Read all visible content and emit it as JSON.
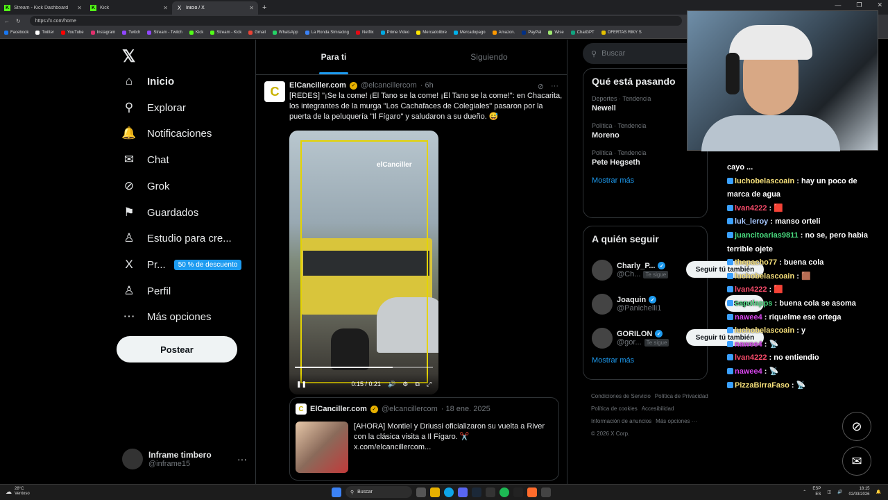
{
  "browser": {
    "tabs": [
      {
        "label": "Stream - Kick Dashboard",
        "icon": "kick-icon",
        "active": false
      },
      {
        "label": "Kick",
        "icon": "kick-icon",
        "active": false
      },
      {
        "label": "Inicio / X",
        "icon": "x-icon",
        "active": true
      }
    ],
    "url": "https://x.com/home",
    "bookmarks": [
      {
        "label": "Facebook",
        "color": "#1877f2"
      },
      {
        "label": "Twitter",
        "color": "#ffffff"
      },
      {
        "label": "YouTube",
        "color": "#ff0000"
      },
      {
        "label": "Instagram",
        "color": "#e1306c"
      },
      {
        "label": "Twitch",
        "color": "#9146ff"
      },
      {
        "label": "Stream - Twitch",
        "color": "#9146ff"
      },
      {
        "label": "Kick",
        "color": "#53fc18"
      },
      {
        "label": "Stream - Kick",
        "color": "#53fc18"
      },
      {
        "label": "Gmail",
        "color": "#ea4335"
      },
      {
        "label": "WhatsApp",
        "color": "#25d366"
      },
      {
        "label": "La Ronda Simracing",
        "color": "#3b82f6"
      },
      {
        "label": "Netflix",
        "color": "#e50914"
      },
      {
        "label": "Prime Video",
        "color": "#00a8e1"
      },
      {
        "label": "Mercadolibre",
        "color": "#ffe600"
      },
      {
        "label": "Mercadopago",
        "color": "#00b1ea"
      },
      {
        "label": "Amazon.",
        "color": "#ff9900"
      },
      {
        "label": "PayPal",
        "color": "#003087"
      },
      {
        "label": "Wise",
        "color": "#9fe870"
      },
      {
        "label": "ChatGPT",
        "color": "#10a37f"
      },
      {
        "label": "OFERTAS RIKY S",
        "color": "#e5c100"
      }
    ]
  },
  "nav": {
    "items": [
      {
        "label": "Inicio",
        "icon": "home-icon",
        "glyph": "⌂",
        "bold": true
      },
      {
        "label": "Explorar",
        "icon": "search-icon",
        "glyph": "⚲"
      },
      {
        "label": "Notificaciones",
        "icon": "bell-icon",
        "glyph": "🔔"
      },
      {
        "label": "Chat",
        "icon": "mail-icon",
        "glyph": "✉"
      },
      {
        "label": "Grok",
        "icon": "grok-icon",
        "glyph": "⊘"
      },
      {
        "label": "Guardados",
        "icon": "bookmark-icon",
        "glyph": "⚑"
      },
      {
        "label": "Estudio para cre...",
        "icon": "studio-icon",
        "glyph": "♙"
      },
      {
        "label": "Pr...",
        "icon": "x-premium-icon",
        "glyph": "X"
      },
      {
        "label": "Perfil",
        "icon": "person-icon",
        "glyph": "♙"
      },
      {
        "label": "Más opciones",
        "icon": "more-circle-icon",
        "glyph": "⋯"
      }
    ],
    "promo_badge": "50 % de descuento",
    "post_button": "Postear",
    "account": {
      "name": "Inframe timbero",
      "handle": "@inframe15"
    }
  },
  "feed": {
    "tabs": [
      "Para ti",
      "Siguiendo"
    ],
    "tweet": {
      "name": "ElCanciller.com",
      "handle": "@elcancillercom",
      "time": "· 6h",
      "text": "[REDES] \"¡Se la come! ¡El Tano se la come! ¡El Tano se la come!\": en Chacarita, los integrantes de la murga \"Los Cachafaces de Colegiales\" pasaron por la puerta de la peluquería \"Il Fígaro\" y saludaron a su dueño. 😅",
      "video": {
        "watermark": "elCanciller",
        "time": "0:15 / 0:21",
        "progress": 0.71
      }
    },
    "quote": {
      "name": "ElCanciller.com",
      "handle": "@elcancillercom",
      "date": "· 18 ene. 2025",
      "text": "[AHORA] Montiel y Driussi oficializaron su vuelta a River con la clásica visita a Il Fígaro. ✂️ x.com/elcancillercom..."
    }
  },
  "right": {
    "search_placeholder": "Buscar",
    "trends_title": "Qué está pasando",
    "trends": [
      {
        "category": "Deportes · Tendencia",
        "name": "Newell"
      },
      {
        "category": "Política · Tendencia",
        "name": "Moreno"
      },
      {
        "category": "Política · Tendencia",
        "name": "Pete Hegseth"
      }
    ],
    "show_more": "Mostrar más",
    "follow_title": "A quién seguir",
    "follow": [
      {
        "name": "Charly_P...",
        "handle": "@Ch...",
        "badge": "Te sigue",
        "button": "Seguir tú también"
      },
      {
        "name": "Joaquin",
        "handle": "@Panichelli1",
        "badge": "",
        "button": "Seguir"
      },
      {
        "name": "GORILON",
        "handle": "@gor...",
        "badge": "Te sigue",
        "button": "Seguir tú también"
      }
    ],
    "footer": [
      "Condiciones de Servicio",
      "Política de Privacidad",
      "Política de cookies",
      "Accesibilidad",
      "Información de anuncios",
      "Más opciones ···",
      "© 2026 X Corp."
    ]
  },
  "chat": [
    {
      "user": "",
      "msg": "cayo ...",
      "color": "#ffffff"
    },
    {
      "user": "luchobelascoain",
      "msg": "hay un poco de marca de agua",
      "color": "#f7e17b"
    },
    {
      "user": "lvan4222",
      "msg": "🟥",
      "color": "#ff4d6d"
    },
    {
      "user": "luk_leroy",
      "msg": "manso orteli",
      "color": "#a8c8ff"
    },
    {
      "user": "juancitoarias9811",
      "msg": "no se, pero habia terrible ojete",
      "color": "#4ade80"
    },
    {
      "user": "thepacho77",
      "msg": "buena cola",
      "color": "#f7e17b"
    },
    {
      "user": "luchobelascoain",
      "msg": "🟫",
      "color": "#f7e17b"
    },
    {
      "user": "lvan4222",
      "msg": "🟥",
      "color": "#ff4d6d"
    },
    {
      "user": "capolapps",
      "msg": "buena cola se asoma",
      "color": "#4ade80"
    },
    {
      "user": "nawee4",
      "msg": "riquelme ese ortega",
      "color": "#d946ef"
    },
    {
      "user": "luchobelascoain",
      "msg": "y",
      "color": "#f7e17b"
    },
    {
      "user": "nawee4",
      "msg": "📡",
      "color": "#d946ef"
    },
    {
      "user": "lvan4222",
      "msg": "no entiendio",
      "color": "#ff4d6d"
    },
    {
      "user": "nawee4",
      "msg": "📡",
      "color": "#d946ef"
    },
    {
      "user": "PizzaBirraFaso",
      "msg": "📡",
      "color": "#f7e17b"
    }
  ],
  "taskbar": {
    "weather_temp": "28°C",
    "weather_desc": "Ventoso",
    "search": "Buscar",
    "lang": "ESP",
    "lang2": "ES",
    "time": "18:15",
    "date": "02/03/2026"
  }
}
